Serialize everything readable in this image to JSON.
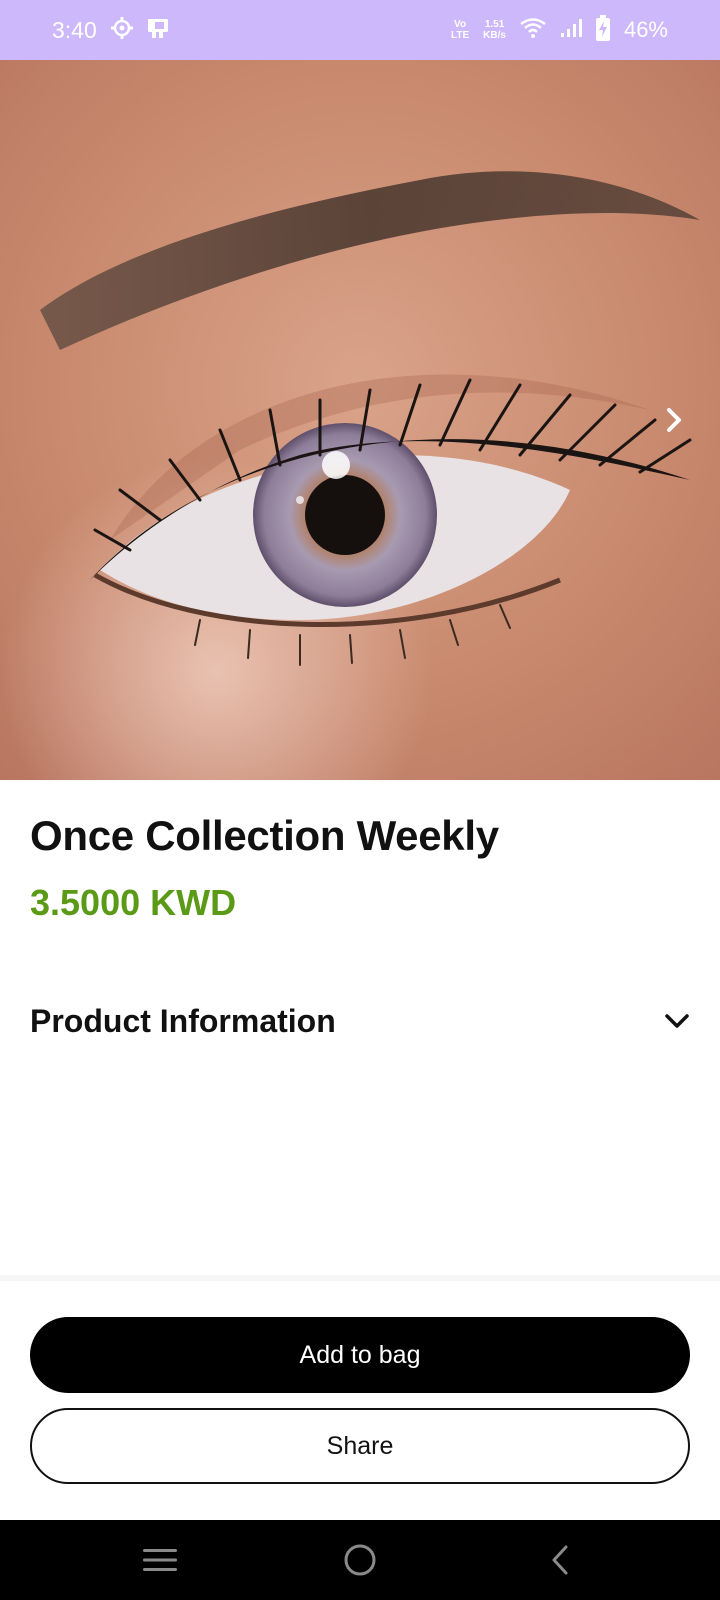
{
  "status_bar": {
    "time": "3:40",
    "network_type_top": "Vo",
    "network_type_bottom": "LTE",
    "speed_value": "1.51",
    "speed_unit": "KB/s",
    "battery_percent": "46%",
    "icons": [
      "settings-gear-icon",
      "notification-app-icon",
      "volte-icon",
      "wifi-icon",
      "signal-icon",
      "battery-charging-icon"
    ]
  },
  "product": {
    "image_alt": "Close-up of eye wearing grey-violet contact lens",
    "title": "Once Collection Weekly",
    "price": "3.5000 KWD",
    "price_color": "#5a9a16"
  },
  "accordion": {
    "label": "Product Information",
    "icon": "chevron-down-icon"
  },
  "actions": {
    "add_to_bag": "Add to bag",
    "share": "Share"
  },
  "nav_bar": {
    "icons": [
      "menu-icon",
      "home-icon",
      "back-icon"
    ]
  }
}
